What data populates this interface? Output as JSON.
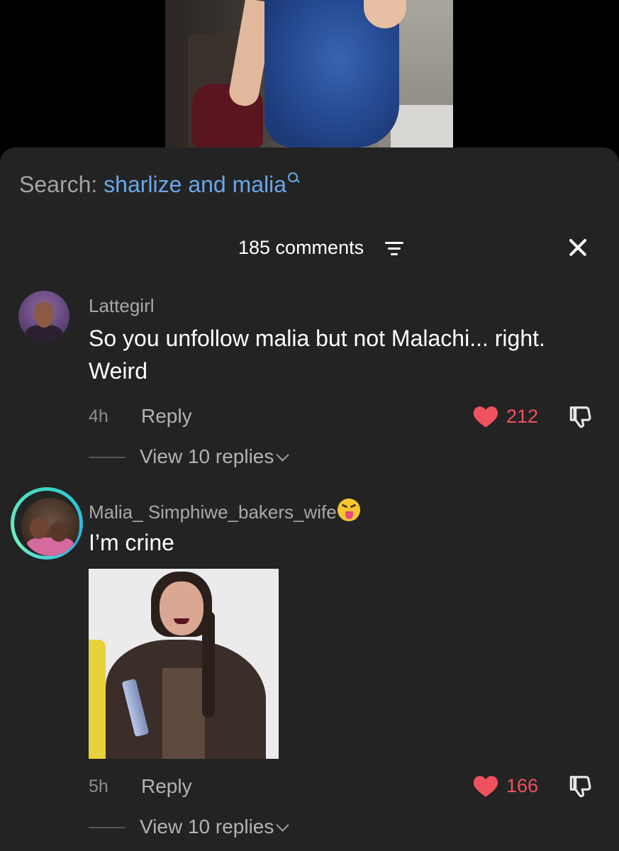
{
  "search": {
    "prefix": "Search:",
    "term": "sharlize and malia"
  },
  "header": {
    "comment_count": "185 comments"
  },
  "comments": [
    {
      "username": "Lattegirl",
      "text_line1": "So you unfollow malia but not Malachi... right.",
      "text_line2": "Weird",
      "time": "4h",
      "reply_label": "Reply",
      "likes": "212",
      "view_replies": "View 10 replies"
    },
    {
      "username": "Malia_ Simphiwe_bakers_wife",
      "text": "I’m crine",
      "time": "5h",
      "reply_label": "Reply",
      "likes": "166",
      "view_replies": "View 10 replies"
    }
  ],
  "colors": {
    "sheet_bg": "#232323",
    "search_term": "#6aa7ea",
    "like_red": "#f0515e",
    "avatar_ring": "#3ad6c5"
  },
  "icons": [
    "search-icon",
    "sort-icon",
    "close-icon",
    "heart-icon",
    "dislike-icon",
    "chevron-down-icon",
    "tongue-emoji-icon"
  ]
}
